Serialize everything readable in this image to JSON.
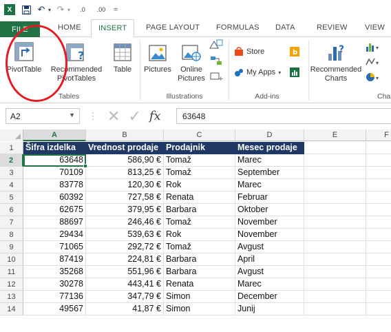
{
  "qat": {
    "app_logo": "X",
    "undo_glyph": "↶",
    "redo_glyph": "↷",
    "inc_decimal": ".0",
    "dec_decimal": ".00",
    "customize_glyph": "="
  },
  "tabs": {
    "file": "FILE",
    "home": "HOME",
    "insert": "INSERT",
    "page_layout": "PAGE LAYOUT",
    "formulas": "FORMULAS",
    "data": "DATA",
    "review": "REVIEW",
    "view": "VIEW"
  },
  "ribbon": {
    "pivot_table": "PivotTable",
    "recommended_pivot_1": "Recommended",
    "recommended_pivot_2": "PivotTables",
    "table": "Table",
    "tables_group": "Tables",
    "pictures": "Pictures",
    "online_pictures_1": "Online",
    "online_pictures_2": "Pictures",
    "illustrations_group": "Illustrations",
    "store": "Store",
    "my_apps": "My Apps",
    "addins_group": "Add-ins",
    "recommended_charts_1": "Recommended",
    "recommended_charts_2": "Charts",
    "charts_group": "Cha"
  },
  "formula_bar": {
    "name_box": "A2",
    "fx": "fx",
    "cancel": "✕",
    "enter": "✓",
    "value": "63648"
  },
  "columns": [
    "A",
    "B",
    "C",
    "D",
    "E",
    "F"
  ],
  "rows": [
    "1",
    "2",
    "3",
    "4",
    "5",
    "6",
    "7",
    "8",
    "9",
    "10",
    "11",
    "12",
    "13",
    "14"
  ],
  "table": {
    "headers": [
      "Šifra izdelka",
      "Vrednost prodaje",
      "Prodajnik",
      "Mesec prodaje"
    ],
    "data": [
      [
        "63648",
        "586,90 €",
        "Tomaž",
        "Marec"
      ],
      [
        "70109",
        "813,25 €",
        "Tomaž",
        "September"
      ],
      [
        "83778",
        "120,30 €",
        "Rok",
        "Marec"
      ],
      [
        "60392",
        "727,58 €",
        "Renata",
        "Februar"
      ],
      [
        "62675",
        "379,95 €",
        "Barbara",
        "Oktober"
      ],
      [
        "88697",
        "246,46 €",
        "Tomaž",
        "November"
      ],
      [
        "29434",
        "539,63 €",
        "Rok",
        "November"
      ],
      [
        "71065",
        "292,72 €",
        "Tomaž",
        "Avgust"
      ],
      [
        "87419",
        "224,81 €",
        "Barbara",
        "April"
      ],
      [
        "35268",
        "551,96 €",
        "Barbara",
        "Avgust"
      ],
      [
        "30278",
        "443,41 €",
        "Renata",
        "Marec"
      ],
      [
        "77136",
        "347,79 €",
        "Simon",
        "December"
      ],
      [
        "49567",
        "41,87 €",
        "Simon",
        "Junij"
      ]
    ]
  },
  "colors": {
    "excel_green": "#217346",
    "header_fill": "#1f3864",
    "highlight_circle": "#e31b23"
  }
}
